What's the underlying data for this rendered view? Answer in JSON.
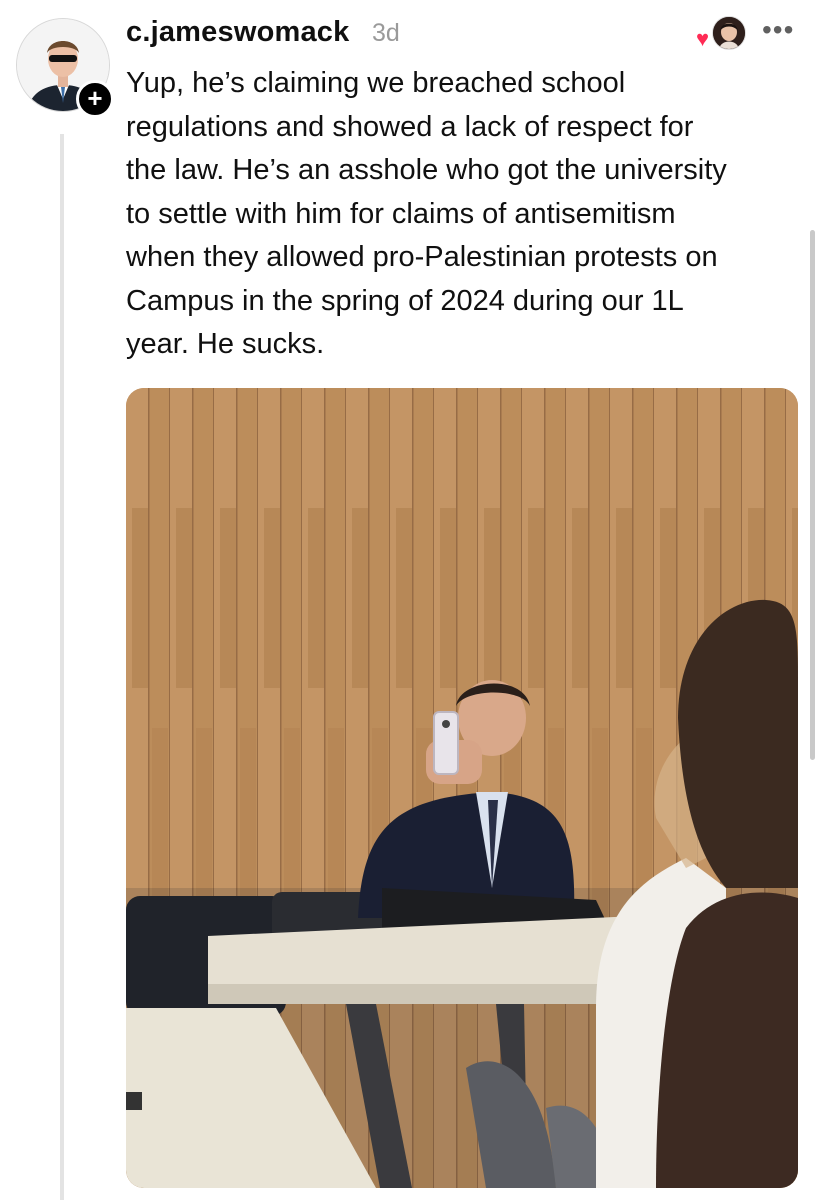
{
  "post": {
    "username": "c.jameswomack",
    "timestamp": "3d",
    "follow_symbol": "+",
    "more_symbol": "•••",
    "text_lines": [
      "Yup, he’s claiming we breached school",
      "regulations and showed a lack of respect for",
      "the law. He’s an asshole who got the university",
      "to settle with him for claims of antisemitism",
      "when they allowed pro-Palestinian protests on",
      "Campus in the spring of 2024 during our 1L",
      "year. He sucks."
    ],
    "liked_icon": "heart-icon",
    "accent_heart": "#ff2b55"
  }
}
